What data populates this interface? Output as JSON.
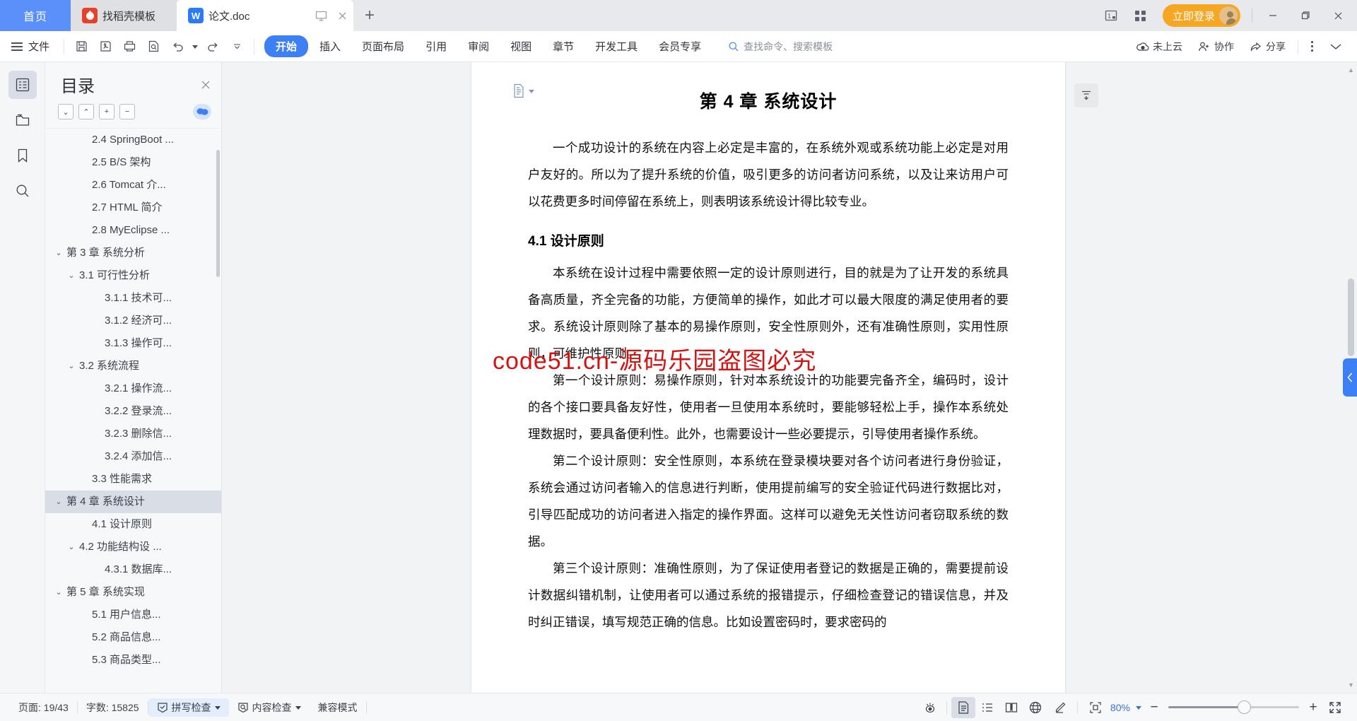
{
  "titlebar": {
    "home_tab": "首页",
    "tabs": [
      {
        "label": "找稻壳模板",
        "icon": "W-logo-red",
        "active": false
      },
      {
        "label": "论文.doc",
        "icon": "W-logo-blue",
        "active": true
      }
    ],
    "new_tab_label": "+",
    "login_button": "立即登录",
    "minimize": "—",
    "maximize": "❐",
    "close": "✕"
  },
  "ribbon": {
    "file_label": "文件",
    "quick_access": [
      "save-icon",
      "print-preview-icon",
      "print-icon",
      "find-icon",
      "undo-icon",
      "redo-icon",
      "more-icon"
    ],
    "menus": [
      {
        "label": "开始",
        "active": true
      },
      {
        "label": "插入",
        "active": false
      },
      {
        "label": "页面布局",
        "active": false
      },
      {
        "label": "引用",
        "active": false
      },
      {
        "label": "审阅",
        "active": false
      },
      {
        "label": "视图",
        "active": false
      },
      {
        "label": "章节",
        "active": false
      },
      {
        "label": "开发工具",
        "active": false
      },
      {
        "label": "会员专享",
        "active": false
      }
    ],
    "search_placeholder": "查找命令、搜索模板",
    "right_items": [
      {
        "label": "未上云",
        "icon": "cloud-icon"
      },
      {
        "label": "协作",
        "icon": "collaborate-icon"
      },
      {
        "label": "分享",
        "icon": "share-icon"
      }
    ],
    "more_icon": "vertical-dots-icon",
    "collapse_icon": "chevron-down-icon"
  },
  "rail": {
    "items": [
      {
        "name": "outline-icon",
        "active": true
      },
      {
        "name": "folder-icon",
        "active": false
      },
      {
        "name": "bookmark-icon",
        "active": false
      },
      {
        "name": "search-icon",
        "active": false
      }
    ]
  },
  "outline": {
    "title": "目录",
    "close_label": "✕",
    "tools": [
      {
        "name": "expand-down-button",
        "glyph": "⌄"
      },
      {
        "name": "collapse-up-button",
        "glyph": "⌃"
      },
      {
        "name": "expand-all-button",
        "glyph": "+"
      },
      {
        "name": "collapse-all-button",
        "glyph": "−"
      }
    ],
    "chat_icon": "comment-icon",
    "items": [
      {
        "label": "2.4 SpringBoot ...",
        "indent": 2,
        "caret": "",
        "selected": false,
        "clipped": true
      },
      {
        "label": "2.5 B/S 架构",
        "indent": 2,
        "caret": "",
        "selected": false
      },
      {
        "label": "2.6 Tomcat 介...",
        "indent": 2,
        "caret": "",
        "selected": false
      },
      {
        "label": "2.7 HTML 简介",
        "indent": 2,
        "caret": "",
        "selected": false
      },
      {
        "label": "2.8 MyEclipse ...",
        "indent": 2,
        "caret": "",
        "selected": false
      },
      {
        "label": "第 3 章  系统分析",
        "indent": 0,
        "caret": "⌄",
        "selected": false
      },
      {
        "label": "3.1  可行性分析",
        "indent": 1,
        "caret": "⌄",
        "selected": false
      },
      {
        "label": "3.1.1 技术可...",
        "indent": 3,
        "caret": "",
        "selected": false
      },
      {
        "label": "3.1.2 经济可...",
        "indent": 3,
        "caret": "",
        "selected": false
      },
      {
        "label": "3.1.3 操作可...",
        "indent": 3,
        "caret": "",
        "selected": false
      },
      {
        "label": "3.2  系统流程",
        "indent": 1,
        "caret": "⌄",
        "selected": false
      },
      {
        "label": "3.2.1 操作流...",
        "indent": 3,
        "caret": "",
        "selected": false
      },
      {
        "label": "3.2.2 登录流...",
        "indent": 3,
        "caret": "",
        "selected": false
      },
      {
        "label": "3.2.3 删除信...",
        "indent": 3,
        "caret": "",
        "selected": false
      },
      {
        "label": "3.2.4 添加信...",
        "indent": 3,
        "caret": "",
        "selected": false
      },
      {
        "label": "3.3  性能需求",
        "indent": 2,
        "caret": "",
        "selected": false
      },
      {
        "label": "第 4 章  系统设计",
        "indent": 0,
        "caret": "⌄",
        "selected": true
      },
      {
        "label": "4.1  设计原则",
        "indent": 2,
        "caret": "",
        "selected": false
      },
      {
        "label": "4.2  功能结构设 ...",
        "indent": 1,
        "caret": "⌄",
        "selected": false
      },
      {
        "label": "4.3.1 数据库...",
        "indent": 3,
        "caret": "",
        "selected": false
      },
      {
        "label": "第 5 章  系统实现",
        "indent": 0,
        "caret": "⌄",
        "selected": false
      },
      {
        "label": "5.1 用户信息...",
        "indent": 2,
        "caret": "",
        "selected": false
      },
      {
        "label": "5.2 商品信息...",
        "indent": 2,
        "caret": "",
        "selected": false
      },
      {
        "label": "5.3 商品类型...",
        "indent": 2,
        "caret": "",
        "selected": false
      }
    ]
  },
  "document": {
    "heading1": "第 4 章  系统设计",
    "paragraph1": "一个成功设计的系统在内容上必定是丰富的，在系统外观或系统功能上必定是对用户友好的。所以为了提升系统的价值，吸引更多的访问者访问系统，以及让来访用户可以花费更多时间停留在系统上，则表明该系统设计得比较专业。",
    "heading2": "4.1  设计原则",
    "paragraph2": "本系统在设计过程中需要依照一定的设计原则进行，目的就是为了让开发的系统具备高质量，齐全完备的功能，方便简单的操作，如此才可以最大限度的满足使用者的要求。系统设计原则除了基本的易操作原则，安全性原则外，还有准确性原则，实用性原则，可维护性原则。",
    "paragraph3": "第一个设计原则：易操作原则，针对本系统设计的功能要完备齐全，编码时，设计的各个接口要具备友好性，使用者一旦使用本系统时，要能够轻松上手，操作本系统处理数据时，要具备便利性。此外，也需要设计一些必要提示，引导使用者操作系统。",
    "paragraph4": "第二个设计原则：安全性原则，本系统在登录模块要对各个访问者进行身份验证，系统会通过访问者输入的信息进行判断，使用提前编写的安全验证代码进行数据比对，引导匹配成功的访问者进入指定的操作界面。这样可以避免无关性访问者窃取系统的数据。",
    "paragraph5": "第三个设计原则：准确性原则，为了保证使用者登记的数据是正确的，需要提前设计数据纠错机制，让使用者可以通过系统的报错提示，仔细检查登记的错误信息，并及时纠正错误，填写规范正确的信息。比如设置密码时，要求密码的",
    "watermark": "code51.cn-源码乐园盗图必究"
  },
  "status": {
    "page": "页面: 19/43",
    "words": "字数: 15825",
    "spellcheck": "拼写检查",
    "contentcheck": "内容检查",
    "compat_mode": "兼容模式",
    "view_buttons": [
      {
        "name": "eye-icon",
        "active": false
      },
      {
        "name": "page-view-icon",
        "active": true
      },
      {
        "name": "outline-view-icon",
        "active": false
      },
      {
        "name": "reading-view-icon",
        "active": false
      },
      {
        "name": "web-view-icon",
        "active": false
      },
      {
        "name": "annotate-icon",
        "active": false
      }
    ],
    "fit-icon": "fit-page-icon",
    "zoom": "80%",
    "zoom_minus": "−",
    "zoom_plus": "+",
    "fullscreen_icon": "fullscreen-icon"
  },
  "colors": {
    "accent_blue": "#3d7ff5",
    "home_tab_blue": "#5b8ff9",
    "login_orange": "#f5a623",
    "watermark_red": "#d41313",
    "tab_red": "#e8402a"
  }
}
